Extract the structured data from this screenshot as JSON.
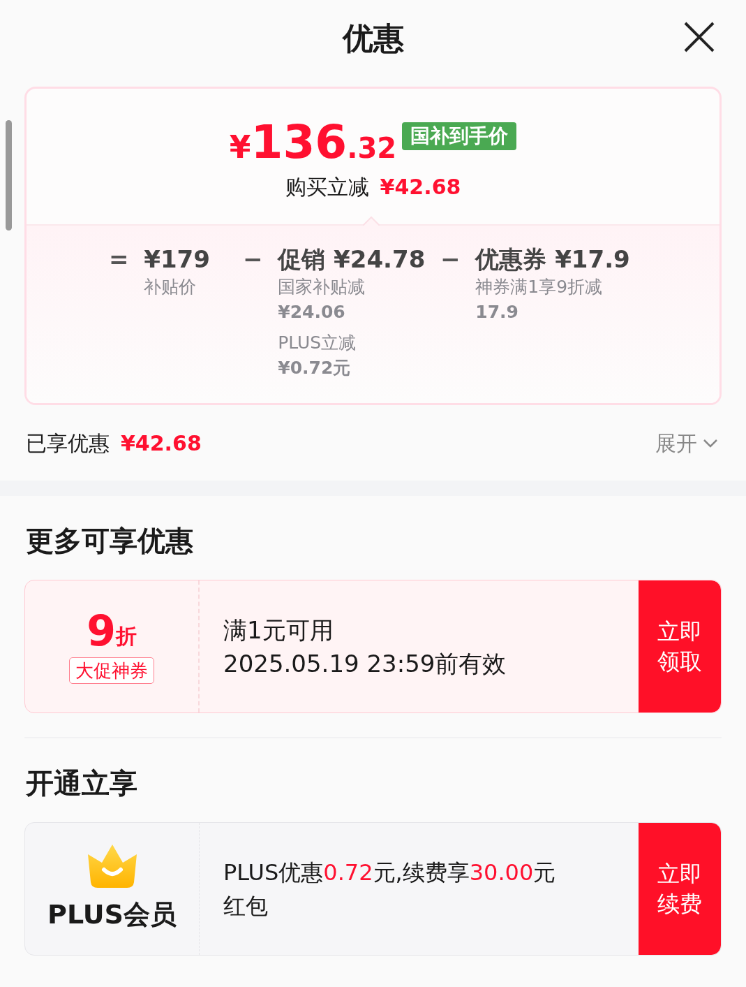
{
  "header": {
    "title": "优惠"
  },
  "price_card": {
    "price": {
      "symbol": "¥",
      "integer": "136",
      "decimal": ".32"
    },
    "tag": "国补到手价",
    "reduction_label": "购买立减",
    "reduction_amount": "¥42.68",
    "breakdown": [
      {
        "operator": "=",
        "title": "¥179",
        "details": [
          {
            "label": "补贴价"
          }
        ]
      },
      {
        "operator": "−",
        "title": "促销 ¥24.78",
        "details": [
          {
            "label": "国家补贴减",
            "amount": "¥24.06"
          },
          {
            "label": "PLUS立减",
            "amount": "¥0.72元"
          }
        ]
      },
      {
        "operator": "−",
        "title": "优惠券 ¥17.9",
        "details": [
          {
            "label": "神券满1享9折减",
            "amount": "17.9"
          }
        ]
      }
    ]
  },
  "summary": {
    "label": "已享优惠",
    "amount": "¥42.68",
    "toggle": "展开",
    "expanded": false
  },
  "sections": [
    {
      "title": "更多可享优惠",
      "card": {
        "kind": "coupon",
        "value": "9",
        "unit": "折",
        "badge": "大促神券",
        "lines": [
          "满1元可用",
          "2025.05.19 23:59前有效"
        ],
        "action": "立即领取"
      }
    },
    {
      "title": "开通立享",
      "card": {
        "kind": "membership",
        "name": "PLUS会员",
        "segments": [
          {
            "text": "PLUS优惠",
            "highlight": false
          },
          {
            "text": "0.72",
            "highlight": true
          },
          {
            "text": "元,续费享",
            "highlight": false
          },
          {
            "text": "30.00",
            "highlight": true
          },
          {
            "text": "元",
            "highlight": false
          },
          {
            "text": "红包",
            "highlight": false
          }
        ],
        "action": "立即续费"
      }
    }
  ]
}
